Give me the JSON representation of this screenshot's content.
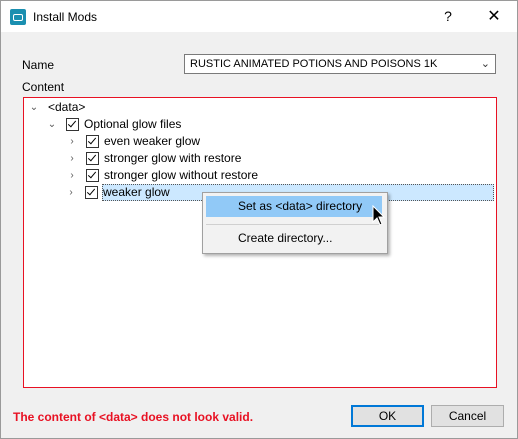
{
  "window": {
    "title": "Install Mods",
    "help_glyph": "?",
    "close_glyph": "✕"
  },
  "form": {
    "name_label": "Name",
    "name_value": "RUSTIC ANIMATED POTIONS AND POISONS 1K",
    "content_label": "Content"
  },
  "tree": {
    "root": "<data>",
    "group": "Optional glow files",
    "items": [
      "even weaker glow",
      "stronger glow with restore",
      "stronger glow without restore",
      "weaker glow"
    ]
  },
  "context_menu": {
    "items": [
      "Set as <data> directory",
      "Create directory..."
    ]
  },
  "status": {
    "error": "The content of <data> does not look valid."
  },
  "buttons": {
    "ok": "OK",
    "cancel": "Cancel"
  },
  "colors": {
    "error": "#e81123",
    "selection": "#cce8ff",
    "menu_highlight": "#91c9f7",
    "accent": "#0078d7"
  }
}
